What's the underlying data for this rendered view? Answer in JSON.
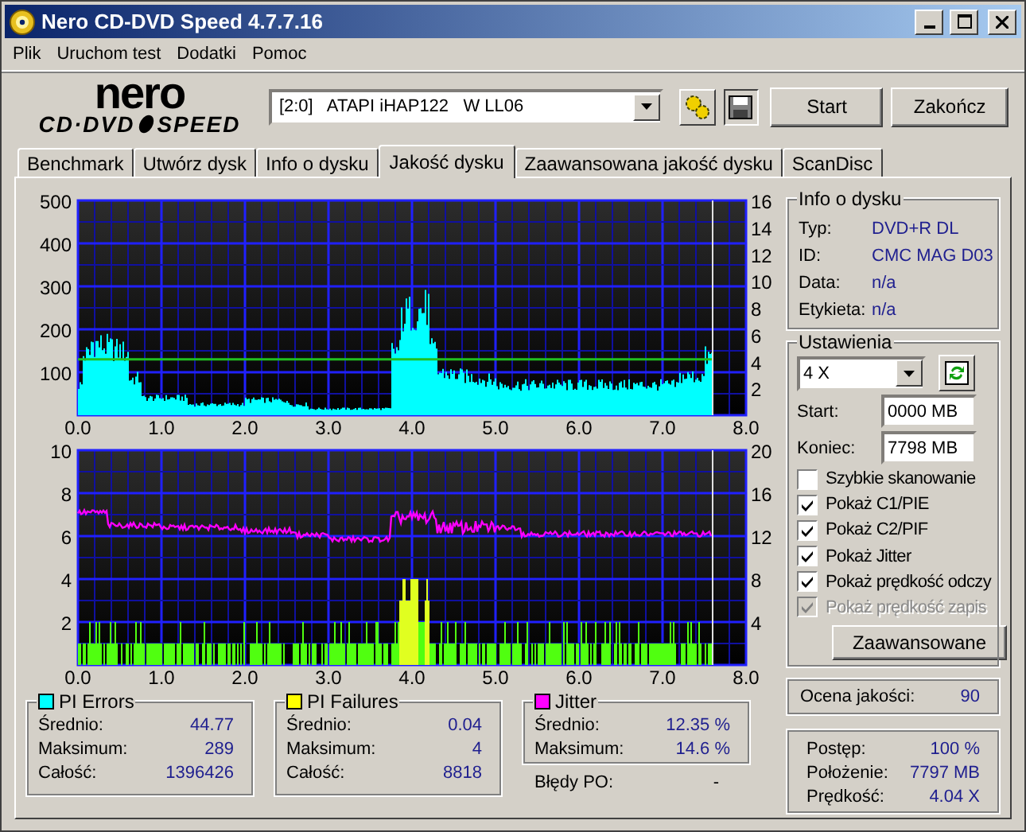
{
  "window": {
    "title": "Nero CD-DVD Speed 4.7.7.16"
  },
  "menu": [
    "Plik",
    "Uruchom test",
    "Dodatki",
    "Pomoc"
  ],
  "logo": {
    "brand": "nero",
    "product_left": "CD·DVD",
    "product_right": "SPEED"
  },
  "drive": {
    "value": "[2:0]   ATAPI iHAP122   W LL06"
  },
  "buttons": {
    "start": "Start",
    "exit": "Zakończ"
  },
  "tabs": [
    {
      "label": "Benchmark",
      "selected": false
    },
    {
      "label": "Utwórz dysk",
      "selected": false
    },
    {
      "label": "Info o dysku",
      "selected": false
    },
    {
      "label": "Jakość dysku",
      "selected": true
    },
    {
      "label": "Zaawansowana jakość dysku",
      "selected": false
    },
    {
      "label": "ScanDisc",
      "selected": false
    }
  ],
  "top_chart": {
    "y_left_ticks": [
      "500",
      "400",
      "300",
      "200",
      "100"
    ],
    "y_right_ticks": [
      "16",
      "14",
      "12",
      "10",
      "8",
      "6",
      "4",
      "2"
    ],
    "x_ticks": [
      "0.0",
      "1.0",
      "2.0",
      "3.0",
      "4.0",
      "5.0",
      "6.0",
      "7.0",
      "8.0"
    ]
  },
  "bottom_chart": {
    "y_left_ticks": [
      "10",
      "8",
      "6",
      "4",
      "2"
    ],
    "y_right_ticks": [
      "20",
      "16",
      "12",
      "8",
      "4"
    ],
    "x_ticks": [
      "0.0",
      "1.0",
      "2.0",
      "3.0",
      "4.0",
      "5.0",
      "6.0",
      "7.0",
      "8.0"
    ]
  },
  "disc_info": {
    "title": "Info o dysku",
    "rows": [
      {
        "label": "Typ:",
        "value": "DVD+R DL"
      },
      {
        "label": "ID:",
        "value": "CMC MAG D03"
      },
      {
        "label": "Data:",
        "value": "n/a"
      },
      {
        "label": "Etykieta:",
        "value": "n/a"
      }
    ]
  },
  "settings": {
    "title": "Ustawienia",
    "speed": "4 X",
    "start_label": "Start:",
    "start_value": "0000 MB",
    "end_label": "Koniec:",
    "end_value": "7798 MB",
    "options": [
      {
        "label": "Szybkie skanowanie",
        "checked": false,
        "disabled": false
      },
      {
        "label": "Pokaż C1/PIE",
        "checked": true,
        "disabled": false
      },
      {
        "label": "Pokaż C2/PIF",
        "checked": true,
        "disabled": false
      },
      {
        "label": "Pokaż Jitter",
        "checked": true,
        "disabled": false
      },
      {
        "label": "Pokaż prędkość odczy",
        "checked": true,
        "disabled": false
      },
      {
        "label": "Pokaż prędkość zapis",
        "checked": true,
        "disabled": true
      }
    ],
    "advanced_button": "Zaawansowane"
  },
  "quality": {
    "label": "Ocena jakości:",
    "value": "90"
  },
  "stats": [
    {
      "title": "PI Errors",
      "color": "#00ffff",
      "rows": [
        {
          "label": "Średnio:",
          "value": "44.77"
        },
        {
          "label": "Maksimum:",
          "value": "289"
        },
        {
          "label": "Całość:",
          "value": "1396426"
        }
      ]
    },
    {
      "title": "PI Failures",
      "color": "#ffff00",
      "rows": [
        {
          "label": "Średnio:",
          "value": "0.04"
        },
        {
          "label": "Maksimum:",
          "value": "4"
        },
        {
          "label": "Całość:",
          "value": "8818"
        }
      ]
    },
    {
      "title": "Jitter",
      "color": "#ff00ff",
      "rows": [
        {
          "label": "Średnio:",
          "value": "12.35 %"
        },
        {
          "label": "Maksimum:",
          "value": "14.6 %"
        }
      ]
    }
  ],
  "po_errors": {
    "label": "Błędy PO:",
    "value": "-"
  },
  "progress": {
    "rows": [
      {
        "label": "Postęp:",
        "value": "100 %"
      },
      {
        "label": "Położenie:",
        "value": "7797 MB"
      },
      {
        "label": "Prędkość:",
        "value": "4.04 X"
      }
    ]
  }
}
